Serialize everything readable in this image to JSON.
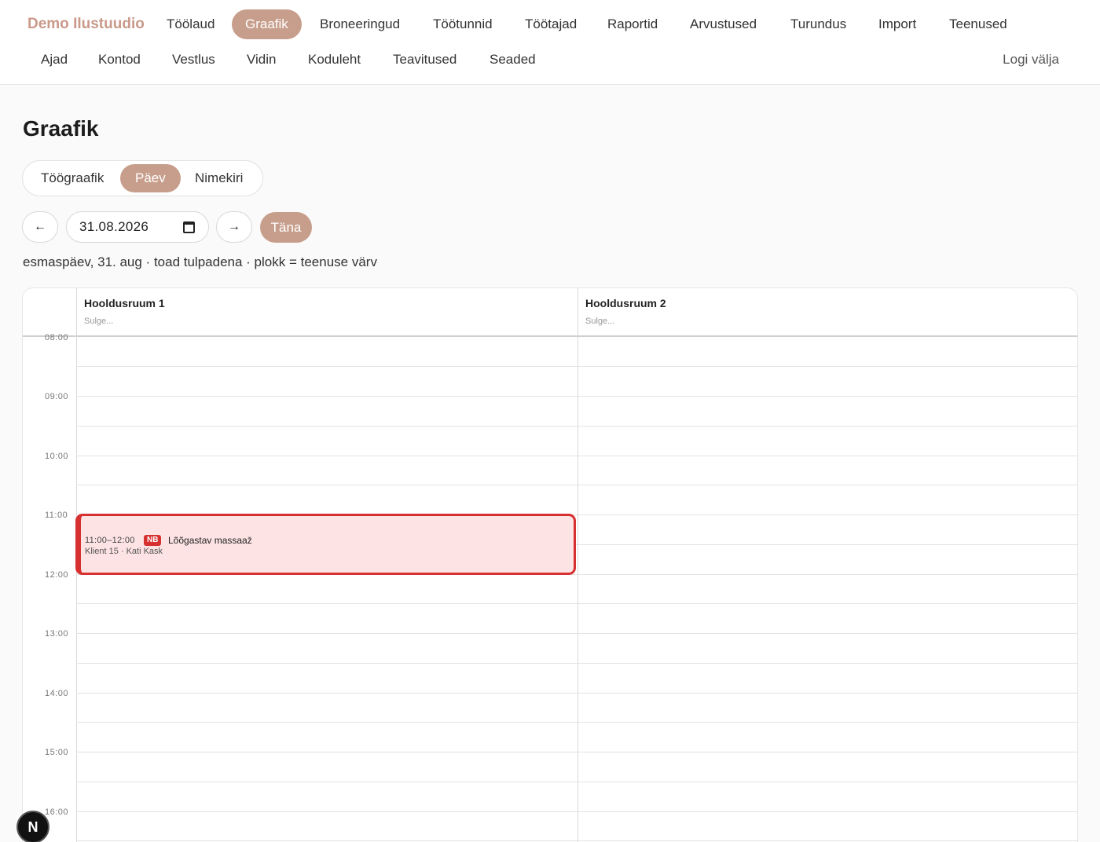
{
  "brand": "Demo Ilustuudio",
  "nav": {
    "row1": [
      "Töölaud",
      "Graafik",
      "Broneeringud",
      "Töötunnid",
      "Töötajad",
      "Raportid",
      "Arvustused",
      "Turundus",
      "Import",
      "Teenused"
    ],
    "row2": [
      "Ajad",
      "Kontod",
      "Vestlus",
      "Vidin",
      "Koduleht",
      "Teavitused",
      "Seaded"
    ],
    "active": "Graafik",
    "logout": "Logi välja"
  },
  "page": {
    "title": "Graafik",
    "view_tabs": [
      "Töögraafik",
      "Päev",
      "Nimekiri"
    ],
    "active_view": "Päev",
    "prev_icon": "←",
    "next_icon": "→",
    "date": "31.08.2026",
    "today_label": "Täna",
    "subtitle": "esmaspäev, 31. aug · toad tulpadena · plokk = teenuse värv"
  },
  "schedule": {
    "rooms": [
      {
        "name": "Hooldusruum 1",
        "sub": "Sulge..."
      },
      {
        "name": "Hooldusruum 2",
        "sub": "Sulge..."
      }
    ],
    "times": [
      "08:00",
      "09:00",
      "10:00",
      "11:00",
      "12:00",
      "13:00",
      "14:00",
      "15:00",
      "16:00"
    ],
    "events": [
      {
        "time": "11:00–12:00",
        "badge": "NB",
        "title": "Lõõgastav massaaž",
        "client": "Klient 15 · Kati Kask",
        "color": "#d63030",
        "bg": "#fde3e3"
      }
    ]
  },
  "floating_badge": "N"
}
